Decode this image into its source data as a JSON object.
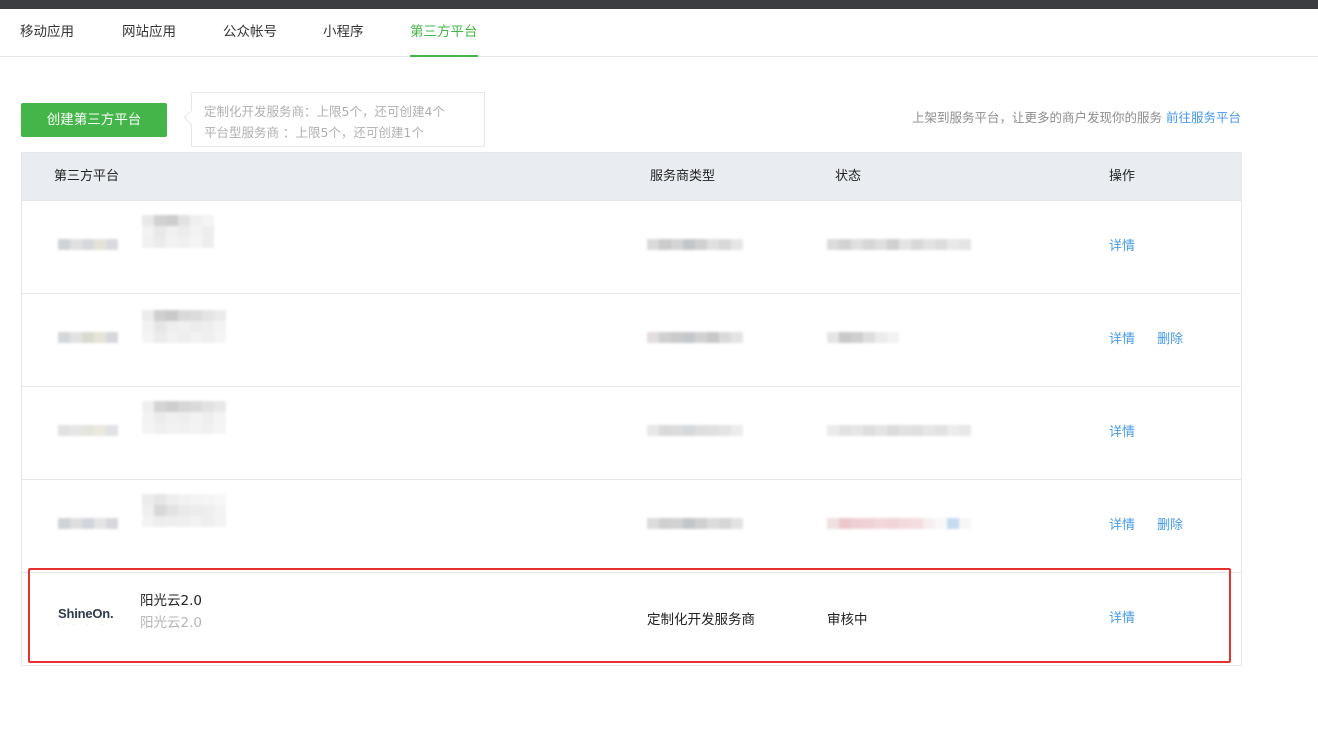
{
  "tabs": [
    {
      "label": "移动应用",
      "active": false
    },
    {
      "label": "网站应用",
      "active": false
    },
    {
      "label": "公众帐号",
      "active": false
    },
    {
      "label": "小程序",
      "active": false
    },
    {
      "label": "第三方平台",
      "active": true
    }
  ],
  "toolbar": {
    "create_label": "创建第三方平台",
    "quota_custom": "定制化开发服务商：上限5个，还可创建4个",
    "quota_platform": "平台型服务商 ：上限5个，还可创建1个",
    "promo_text": "上架到服务平台，让更多的商户发现你的服务",
    "promo_link": "前往服务平台"
  },
  "table": {
    "headers": [
      "第三方平台",
      "服务商类型",
      "状态",
      "操作"
    ],
    "rows": [
      {
        "redacted": true,
        "ops": [
          "详情"
        ]
      },
      {
        "redacted": true,
        "ops": [
          "详情",
          "删除"
        ]
      },
      {
        "redacted": true,
        "ops": [
          "详情"
        ]
      },
      {
        "redacted": true,
        "ops": [
          "详情",
          "删除"
        ]
      },
      {
        "redacted": false,
        "logo_text": "ShineOn.",
        "name": "阳光云2.0",
        "subname": "阳光云2.0",
        "type": "定制化开发服务商",
        "status": "审核中",
        "ops": [
          "详情"
        ]
      }
    ]
  },
  "colors": {
    "accent_green": "#44b549",
    "link_blue": "#459ae9",
    "highlight_red": "#e8302d",
    "topbar": "#3b3d40"
  }
}
